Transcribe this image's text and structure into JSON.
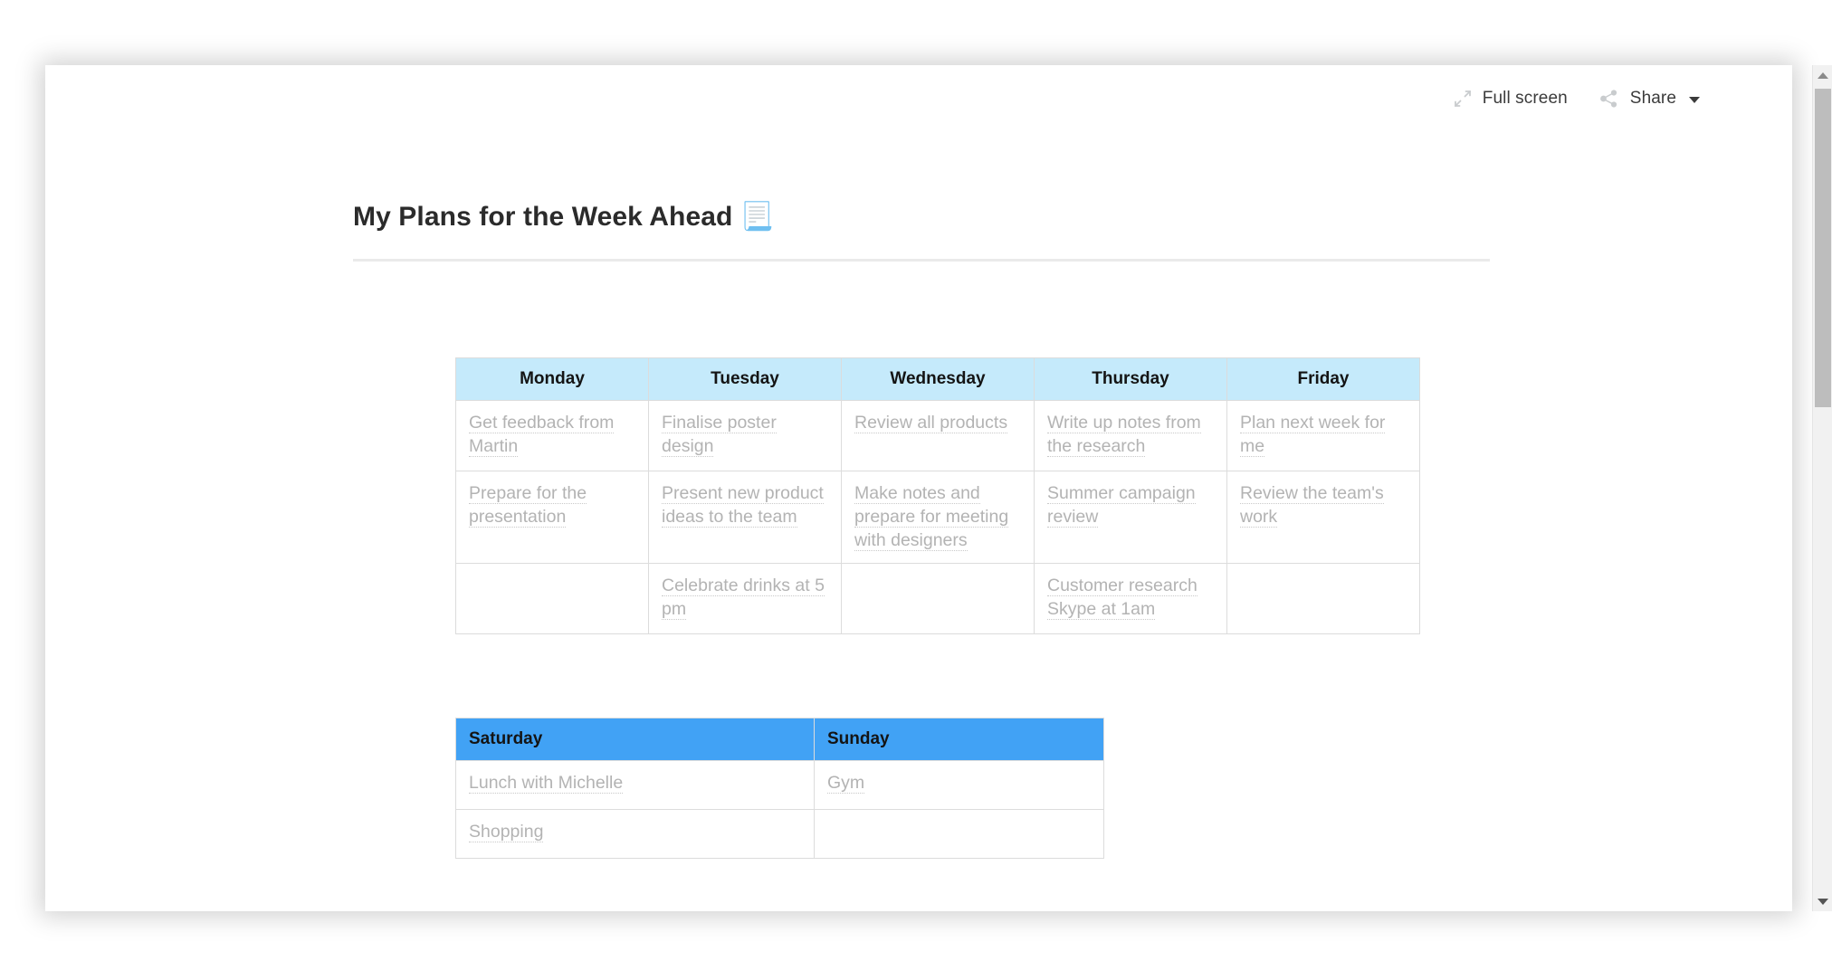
{
  "toolbar": {
    "fullscreen_label": "Full screen",
    "share_label": "Share",
    "fullscreen_icon": "fullscreen-expand-icon",
    "share_icon": "share-nodes-icon",
    "caret_icon": "chevron-down-icon"
  },
  "document": {
    "title": "My Plans for the Week Ahead 📃"
  },
  "weekday_table": {
    "header_bg": "#c5eafb",
    "headers": [
      "Monday",
      "Tuesday",
      "Wednesday",
      "Thursday",
      "Friday"
    ],
    "rows": [
      [
        "Get feedback from Martin",
        "Finalise poster design",
        "Review all products",
        "Write up notes from the research",
        "Plan next week for me"
      ],
      [
        "Prepare for the presentation",
        "Present new product ideas to the team",
        "Make notes and prepare for meeting with designers",
        "Summer campaign review",
        "Review the team's work"
      ],
      [
        "",
        "Celebrate drinks at 5 pm",
        "",
        "Customer research Skype at 1am",
        ""
      ]
    ]
  },
  "weekend_table": {
    "header_bg": "#41a2f5",
    "headers": [
      "Saturday",
      "Sunday"
    ],
    "rows": [
      [
        "Lunch with Michelle",
        "Gym"
      ],
      [
        "Shopping ",
        ""
      ]
    ]
  }
}
